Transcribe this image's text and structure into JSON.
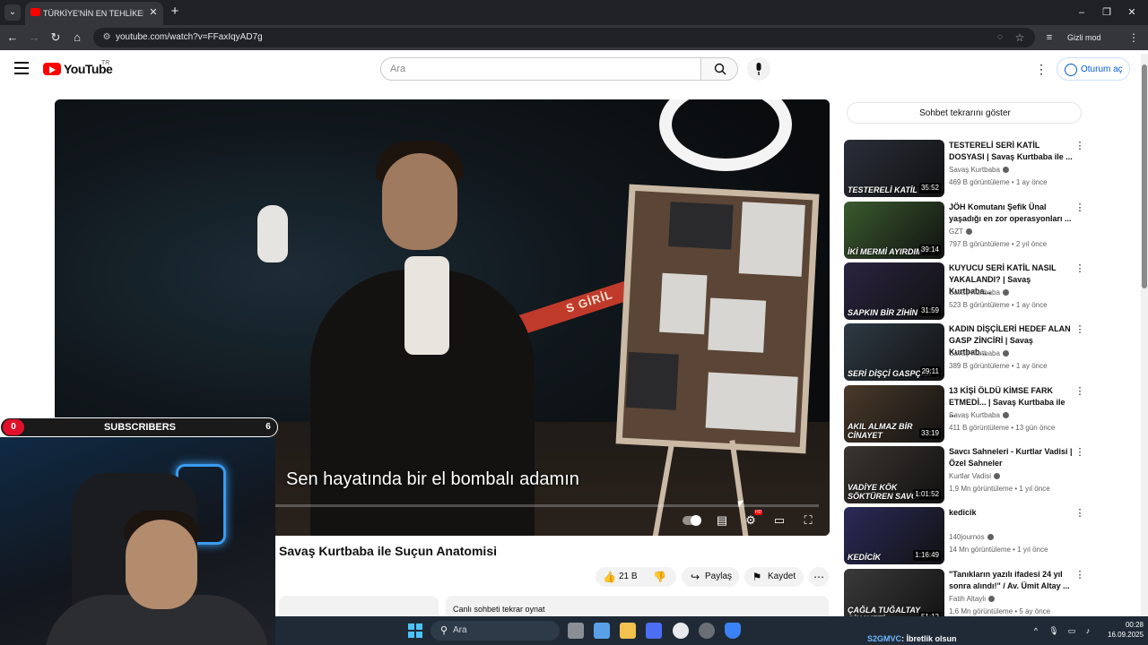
{
  "browser": {
    "tab_title": "TÜRKİYE'NİN EN TEHLİKELİ SERİ KATİLLERİ",
    "url": "youtube.com/watch?v=FFaxIqyAD7g",
    "incognito_label": "Gizli mod",
    "tab_close_glyph": "✕",
    "new_tab_glyph": "+"
  },
  "masthead": {
    "logo_text": "YouTube",
    "region": "TR",
    "search_placeholder": "Ara",
    "signin_label": "Oturum aç"
  },
  "player": {
    "caption": "Sen hayatında bir el bombalı adamın",
    "tape_text": "S GİRİL",
    "hd_badge": "HD"
  },
  "video": {
    "title": "Savaş Kurtbaba ile Suçun Anatomisi",
    "likes": "21 B",
    "share_label": "Paylaş",
    "save_label": "Kaydet",
    "chat_replay_label": "Canlı sohbeti tekrar oynat"
  },
  "sidebar": {
    "chat_toggle_label": "Sohbet tekrarını göster",
    "recommendations": [
      {
        "title": "TESTERELİ SERİ KATİL DOSYASI | Savaş Kurtbaba ile ...",
        "channel": "Savaş Kurtbaba",
        "verified": true,
        "meta": "469 B görüntüleme • 1 ay önce",
        "duration": "35:52",
        "thumb_text": "TESTERELİ KATİL",
        "thumb_color": "#2a2e3a"
      },
      {
        "title": "JÖH Komutanı Şefik Ünal yaşadığı en zor operasyonları ...",
        "channel": "GZT",
        "verified": true,
        "meta": "797 B görüntüleme • 2 yıl önce",
        "duration": "39:14",
        "thumb_text": "İKİ MERMİ AYIRDIM",
        "thumb_color": "#3a5a2e"
      },
      {
        "title": "KUYUCU SERİ KATİL NASIL YAKALANDI? | Savaş Kurtbaba...",
        "channel": "Savaş Kurtbaba",
        "verified": true,
        "meta": "523 B görüntüleme • 1 ay önce",
        "duration": "31:59",
        "thumb_text": "SAPKIN BİR ZİHİN",
        "thumb_color": "#2a2440"
      },
      {
        "title": "KADIN DİŞÇİLERİ HEDEF ALAN GASP ZİNCİRİ | Savaş Kurtbab...",
        "channel": "Savaş Kurtbaba",
        "verified": true,
        "meta": "389 B görüntüleme • 1 ay önce",
        "duration": "29:11",
        "thumb_text": "SERİ DİŞÇİ GASPÇISI",
        "thumb_color": "#2e3a44"
      },
      {
        "title": "13 KİŞİ ÖLDÜ KİMSE FARK ETMEDİ... | Savaş Kurtbaba ile ...",
        "channel": "Savaş Kurtbaba",
        "verified": true,
        "meta": "411 B görüntüleme • 13 gün önce",
        "duration": "33:19",
        "thumb_text": "AKIL ALMAZ BİR CİNAYET",
        "thumb_color": "#4a3a2a"
      },
      {
        "title": "Savcı Sahneleri - Kurtlar Vadisi | Özel Sahneler",
        "channel": "Kurtlar Vadisi",
        "verified": true,
        "meta": "1,9 Mn görüntüleme • 1 yıl önce",
        "duration": "1:01:52",
        "thumb_text": "VADİYE KÖK SÖKTÜREN SAVCI",
        "thumb_color": "#3a3530"
      },
      {
        "title": "kedicik",
        "channel": "140journos",
        "verified": true,
        "meta": "14 Mn görüntüleme • 1 yıl önce",
        "duration": "1:16:49",
        "thumb_text": "KEDİCİK",
        "thumb_color": "#2a2a5a"
      },
      {
        "title": "\"Tanıkların yazılı ifadesi 24 yıl sonra alındı!\" / Av. Ümit Altay ...",
        "channel": "Fatih Altaylı",
        "verified": true,
        "meta": "1,6 Mn görüntüleme • 5 ay önce",
        "duration": "51:12",
        "thumb_text": "ÇAĞLA TUĞALTAY CİNAYETİ",
        "thumb_color": "#3a3a3a"
      }
    ]
  },
  "overlay": {
    "sub_label": "SUBSCRIBERS",
    "sub_left": "0",
    "sub_right": "6"
  },
  "taskbar": {
    "search_label": "Ara",
    "chat_user": "S2GMVC",
    "chat_message": ": İbretlik olsun",
    "time": "00:28",
    "date": "16.09.2025"
  }
}
